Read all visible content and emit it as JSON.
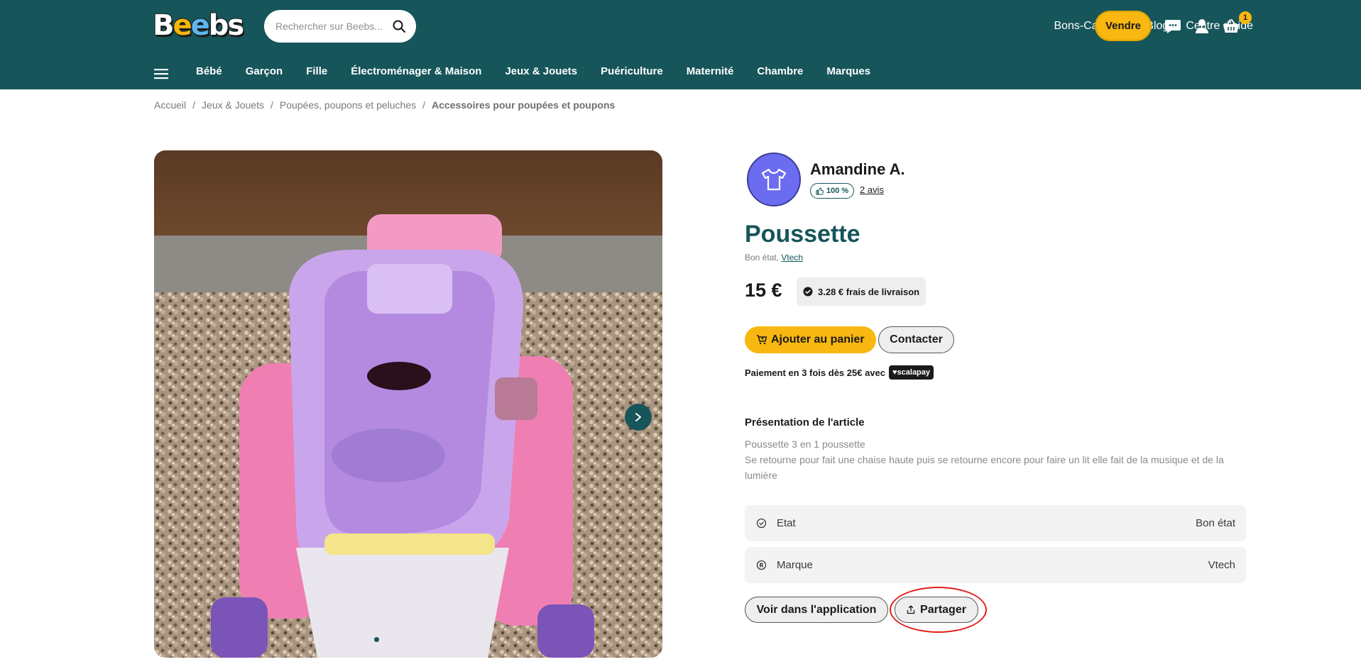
{
  "header": {
    "logo_text": "Beebs",
    "search_placeholder": "Rechercher sur Beebs...",
    "links": [
      "Bons-Cadeaux",
      "Blog",
      "Centre d'aide"
    ],
    "sell_label": "Vendre",
    "cart_count": "1"
  },
  "nav": {
    "items": [
      "Bébé",
      "Garçon",
      "Fille",
      "Électroménager & Maison",
      "Jeux & Jouets",
      "Puériculture",
      "Maternité",
      "Chambre",
      "Marques"
    ]
  },
  "breadcrumb": [
    "Accueil",
    "Jeux & Jouets",
    "Poupées, poupons et peluches",
    "Accessoires pour poupées et poupons"
  ],
  "seller": {
    "name": "Amandine A.",
    "rating": "100 %",
    "reviews": "2 avis"
  },
  "product": {
    "title": "Poussette",
    "condition": "Bon état,",
    "brand": "Vtech",
    "price": "15 €",
    "shipping": "3.28 € frais de livraison",
    "add_to_cart": "Ajouter au panier",
    "contact": "Contacter",
    "payment_text": "Paiement en 3 fois dès 25€ avec",
    "payment_brand": "scalapay",
    "section_title": "Présentation de l'article",
    "description_lines": [
      "Poussette 3 en 1 poussette",
      "Se retourne pour fait une chaise haute puis se retourne encore pour faire un lit elle fait de la musique et de la lumière"
    ],
    "attributes": [
      {
        "label": "Etat",
        "value": "Bon état",
        "icon": "check-badge-icon"
      },
      {
        "label": "Marque",
        "value": "Vtech",
        "icon": "registered-icon"
      }
    ],
    "view_in_app": "Voir dans l'application",
    "share": "Partager"
  },
  "colors": {
    "brand_teal": "#16555a",
    "accent_yellow": "#f8b711",
    "highlight_red": "#e0201b"
  }
}
